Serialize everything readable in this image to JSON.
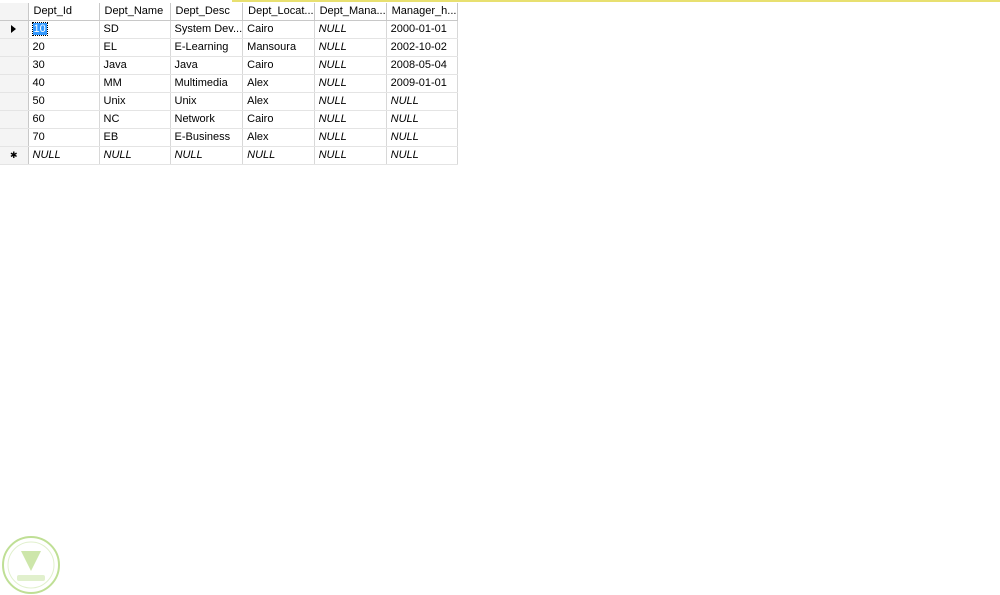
{
  "grid": {
    "columns": [
      "Dept_Id",
      "Dept_Name",
      "Dept_Desc",
      "Dept_Locat...",
      "Dept_Mana...",
      "Manager_h..."
    ],
    "rows": [
      [
        "10",
        "SD",
        "System Dev...",
        "Cairo",
        "NULL",
        "2000-01-01"
      ],
      [
        "20",
        "EL",
        "E-Learning",
        "Mansoura",
        "NULL",
        "2002-10-02"
      ],
      [
        "30",
        "Java",
        "Java",
        "Cairo",
        "NULL",
        "2008-05-04"
      ],
      [
        "40",
        "MM",
        "Multimedia",
        "Alex",
        "NULL",
        "2009-01-01"
      ],
      [
        "50",
        "Unix",
        "Unix",
        "Alex",
        "NULL",
        "NULL"
      ],
      [
        "60",
        "NC",
        "Network",
        "Cairo",
        "NULL",
        "NULL"
      ],
      [
        "70",
        "EB",
        "E-Business",
        "Alex",
        "NULL",
        "NULL"
      ]
    ],
    "new_row": [
      "NULL",
      "NULL",
      "NULL",
      "NULL",
      "NULL",
      "NULL"
    ],
    "current_row_indicator": "triangle-right-icon",
    "new_row_indicator": "asterisk-icon"
  },
  "colors": {
    "selection": "#3399ff",
    "accent_bar": "#e8e070",
    "watermark": "#8cc63f"
  }
}
